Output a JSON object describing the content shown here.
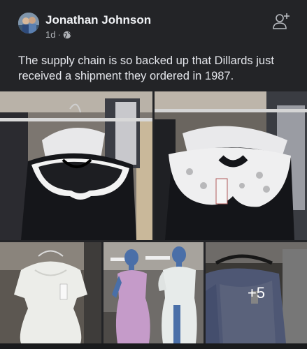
{
  "post": {
    "author": "Jonathan Johnson",
    "time": "1d",
    "separator": "·",
    "text": "The supply chain is so backed up that Dillards just received a shipment they ordered in 1987.",
    "privacy_icon": "globe-icon",
    "add_friend_icon": "add-friend-icon"
  },
  "gallery": {
    "more_count": "+5"
  },
  "colors": {
    "background": "#232427",
    "text": "#e4e6eb",
    "meta": "#b0b3b8"
  }
}
